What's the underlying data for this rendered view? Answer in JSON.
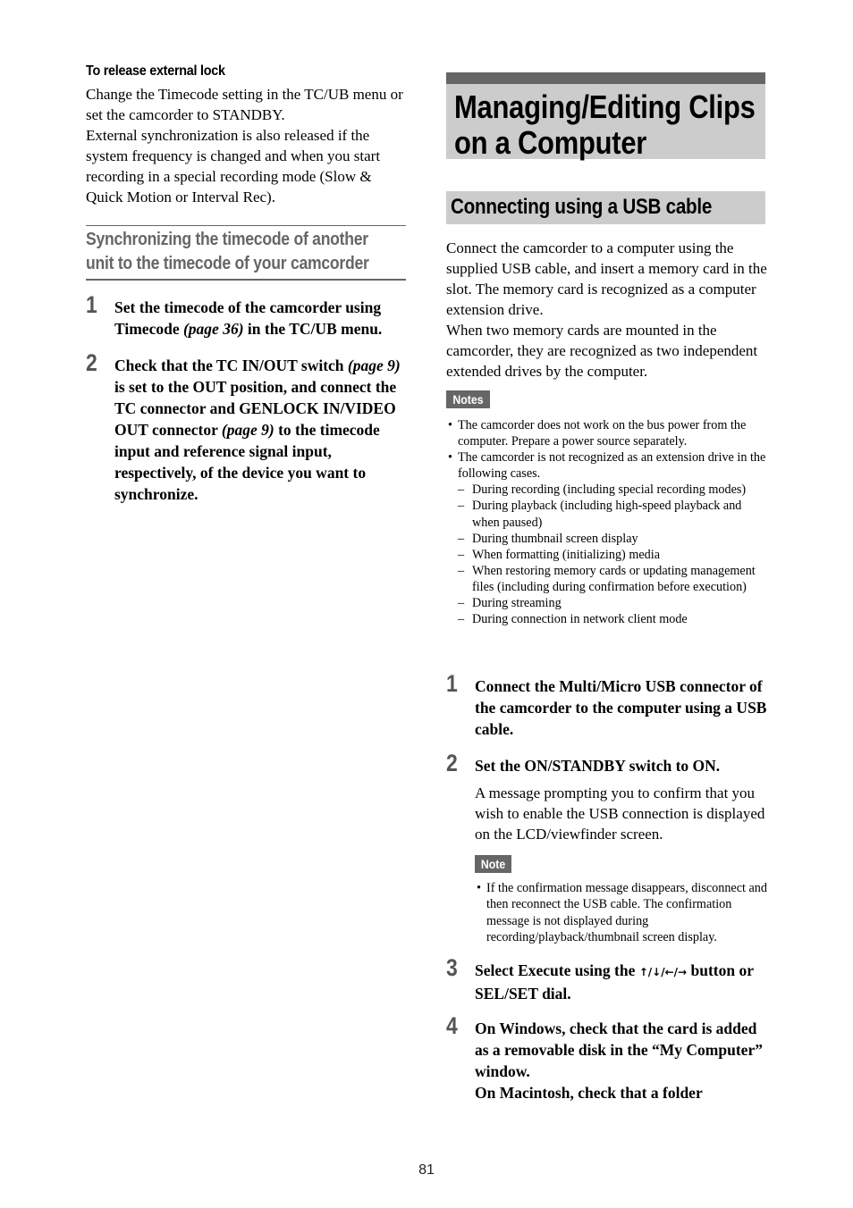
{
  "left_column": {
    "release_lock": {
      "heading": "To release external lock",
      "paragraphs": [
        "Change the Timecode setting in the TC/UB menu or set the camcorder to STANDBY.",
        "External synchronization is also released if the system frequency is changed and when you start recording in a special recording mode (Slow & Quick Motion or Interval Rec)."
      ]
    },
    "sync_section": {
      "heading_line1": "Synchronizing the timecode of another",
      "heading_line2": "unit to the timecode of your camcorder",
      "steps": [
        {
          "number": "1",
          "text_before": "Set the timecode of the camcorder using Timecode ",
          "link": "(page 36)",
          "text_after": " in the TC/UB menu."
        },
        {
          "number": "2",
          "seg1": "Check that the TC IN/OUT switch ",
          "link1": "(page 9)",
          "seg2": " is set to the OUT position, and connect the TC connector and GENLOCK IN/VIDEO OUT connector ",
          "link2": "(page 9)",
          "seg3": " to the timecode input and reference signal input, respectively, of the device you want to synchronize."
        }
      ]
    }
  },
  "right_column": {
    "chapter_title_line1": "Managing/Editing Clips",
    "chapter_title_line2": "on a Computer",
    "section_title": "Connecting using a USB cable",
    "intro_paragraphs": [
      "Connect the camcorder to a computer using the supplied USB cable, and insert a memory card in the slot. The memory card is recognized as a computer extension drive.",
      "When two memory cards are mounted in the camcorder, they are recognized as two independent extended drives by the computer."
    ],
    "notes_label": "Notes",
    "notes": [
      "The camcorder does not work on the bus power from the computer. Prepare a power source separately.",
      "The camcorder is not recognized as an extension drive in the following cases."
    ],
    "dash_mark": "–",
    "cases": [
      "During recording (including special recording modes)",
      "During playback (including high-speed playback and when paused)",
      "During thumbnail screen display",
      "When formatting (initializing) media",
      "When restoring memory cards or updating management files (including during confirmation before execution)",
      "During streaming",
      "During connection in network client mode"
    ],
    "steps": [
      {
        "number": "1",
        "text": "Connect the Multi/Micro USB connector of the camcorder to the computer using a USB cable."
      },
      {
        "number": "2",
        "text": "Set the ON/STANDBY switch to ON.",
        "description": "A message prompting you to confirm that you wish to enable the USB connection is displayed on the LCD/viewfinder screen.",
        "note_label": "Note",
        "note": "If the confirmation message disappears, disconnect and then reconnect the USB cable. The confirmation message is not displayed during recording/playback/thumbnail screen display."
      },
      {
        "number": "3",
        "text_before": "Select Execute using the ",
        "arrows": "↑/↓/←/→",
        "arrow_icons": [
          "arrow-up-icon",
          "arrow-down-icon",
          "arrow-left-icon",
          "arrow-right-icon"
        ],
        "text_after": " button or SEL/SET dial."
      },
      {
        "number": "4",
        "line1": "On Windows, check that the card is added as a removable disk in the “My Computer” window.",
        "line2": "On Macintosh, check that a folder"
      }
    ]
  },
  "page_number": "81",
  "colors": {
    "accent_dark_gray": "#666666",
    "heading_band_gray": "#cccccc"
  }
}
